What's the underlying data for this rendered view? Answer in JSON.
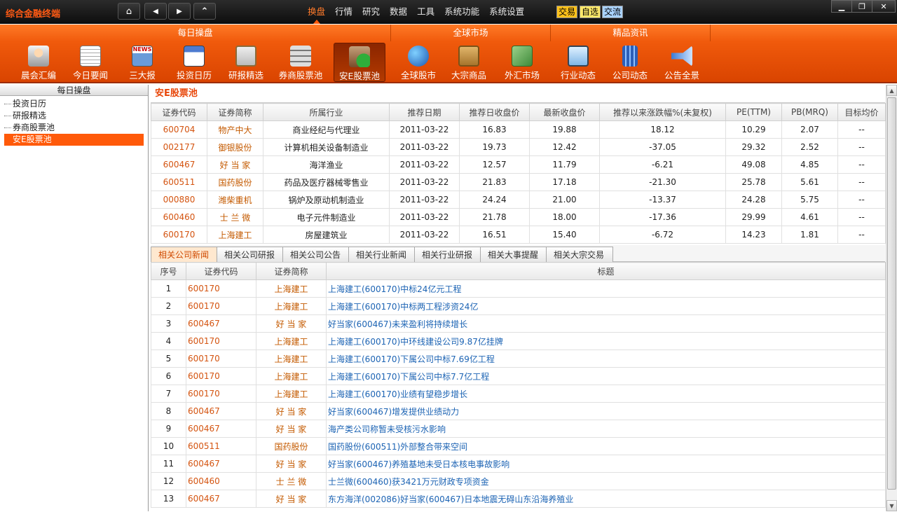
{
  "app": {
    "title": "综合金融终端",
    "nav": {
      "home": "⌂",
      "back": "◀",
      "forward": "▶",
      "top": "⌃"
    },
    "menu": [
      "换盘",
      "行情",
      "研究",
      "数据",
      "工具",
      "系统功能",
      "系统设置"
    ],
    "menu_active": "换盘",
    "quick": [
      "交易",
      "自选",
      "交流"
    ],
    "window": {
      "minimize": "▁",
      "restore": "❐",
      "close": "✕"
    }
  },
  "ribbon": {
    "groups": [
      "每日操盘",
      "全球市场",
      "精品资讯"
    ],
    "buttons": [
      "晨会汇编",
      "今日要闻",
      "三大报",
      "投资日历",
      "研报精选",
      "券商股票池",
      "安E股票池",
      "全球股市",
      "大宗商品",
      "外汇市场",
      "行业动态",
      "公司动态",
      "公告全景"
    ],
    "active": "安E股票池",
    "icon_news_text": "NEWS"
  },
  "sidebar": {
    "title": "每日操盘",
    "items": [
      "投资日历",
      "研报精选",
      "券商股票池",
      "安E股票池"
    ],
    "selected": "安E股票池"
  },
  "pool": {
    "title": "安E股票池",
    "columns": [
      "证券代码",
      "证券简称",
      "所属行业",
      "推荐日期",
      "推荐日收盘价",
      "最新收盘价",
      "推荐以来涨跌幅%(未复权)",
      "PE(TTM)",
      "PB(MRQ)",
      "目标均价"
    ],
    "rows": [
      [
        "600704",
        "物产中大",
        "商业经纪与代理业",
        "2011-03-22",
        "16.83",
        "19.88",
        "18.12",
        "10.29",
        "2.07",
        "--"
      ],
      [
        "002177",
        "御银股份",
        "计算机相关设备制造业",
        "2011-03-22",
        "19.73",
        "12.42",
        "-37.05",
        "29.32",
        "2.52",
        "--"
      ],
      [
        "600467",
        "好 当 家",
        "海洋渔业",
        "2011-03-22",
        "12.57",
        "11.79",
        "-6.21",
        "49.08",
        "4.85",
        "--"
      ],
      [
        "600511",
        "国药股份",
        "药品及医疗器械零售业",
        "2011-03-22",
        "21.83",
        "17.18",
        "-21.30",
        "25.78",
        "5.61",
        "--"
      ],
      [
        "000880",
        "潍柴重机",
        "锅炉及原动机制造业",
        "2011-03-22",
        "24.24",
        "21.00",
        "-13.37",
        "24.28",
        "5.75",
        "--"
      ],
      [
        "600460",
        "士 兰 微",
        "电子元件制造业",
        "2011-03-22",
        "21.78",
        "18.00",
        "-17.36",
        "29.99",
        "4.61",
        "--"
      ],
      [
        "600170",
        "上海建工",
        "房屋建筑业",
        "2011-03-22",
        "16.51",
        "15.40",
        "-6.72",
        "14.23",
        "1.81",
        "--"
      ]
    ]
  },
  "tabs": {
    "items": [
      "相关公司新闻",
      "相关公司研报",
      "相关公司公告",
      "相关行业新闻",
      "相关行业研报",
      "相关大事提醒",
      "相关大宗交易"
    ],
    "active": "相关公司新闻"
  },
  "news": {
    "columns": [
      "序号",
      "证券代码",
      "证券简称",
      "标题"
    ],
    "rows": [
      [
        "1",
        "600170",
        "上海建工",
        "上海建工(600170)中标24亿元工程"
      ],
      [
        "2",
        "600170",
        "上海建工",
        "上海建工(600170)中标两工程涉资24亿"
      ],
      [
        "3",
        "600467",
        "好 当 家",
        "好当家(600467)未来盈利将持续增长"
      ],
      [
        "4",
        "600170",
        "上海建工",
        "上海建工(600170)中环线建设公司9.87亿挂牌"
      ],
      [
        "5",
        "600170",
        "上海建工",
        "上海建工(600170)下属公司中标7.69亿工程"
      ],
      [
        "6",
        "600170",
        "上海建工",
        "上海建工(600170)下属公司中标7.7亿工程"
      ],
      [
        "7",
        "600170",
        "上海建工",
        "上海建工(600170)业绩有望稳步增长"
      ],
      [
        "8",
        "600467",
        "好 当 家",
        "好当家(600467)增发提供业绩动力"
      ],
      [
        "9",
        "600467",
        "好 当 家",
        "海产类公司称暂未受核污水影响"
      ],
      [
        "10",
        "600511",
        "国药股份",
        "国药股份(600511)外部整合带来空间"
      ],
      [
        "11",
        "600467",
        "好 当 家",
        "好当家(600467)养殖基地未受日本核电事故影响"
      ],
      [
        "12",
        "600460",
        "士 兰 微",
        "士兰微(600460)获3421万元财政专项资金"
      ],
      [
        "13",
        "600467",
        "好 当 家",
        "东方海洋(002086)好当家(600467)日本地震无碍山东沿海养殖业"
      ]
    ]
  },
  "scrollbar": {
    "up": "▲",
    "down": "▼"
  },
  "colors": {
    "accent": "#f05a0c",
    "code": "#d45410",
    "link": "#1d64b4"
  }
}
